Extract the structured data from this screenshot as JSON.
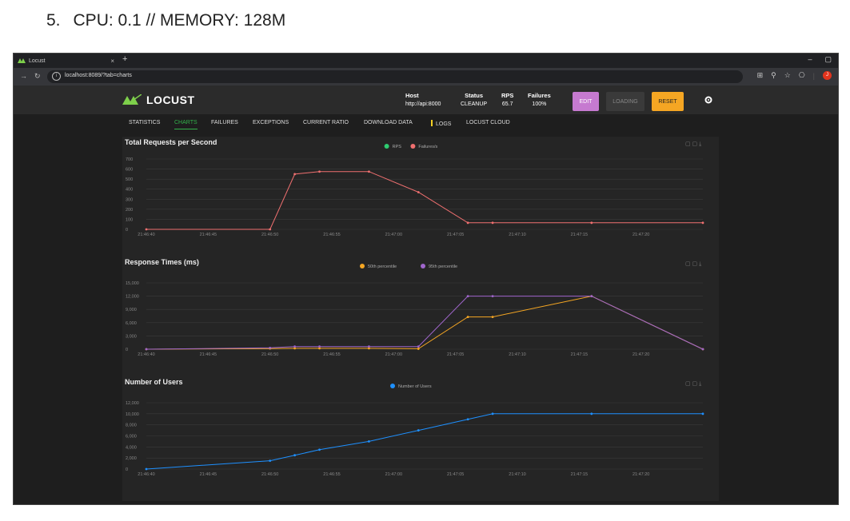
{
  "doc": {
    "number": "5.",
    "heading": "CPU: 0.1 // MEMORY: 128M"
  },
  "browser": {
    "tab_title": "Locust",
    "tab_close": "×",
    "new_tab": "+",
    "url": "localhost:8089/?tab=charts",
    "win_min": "–",
    "win_restore": "▢",
    "profile_initial": "J"
  },
  "header": {
    "logo": "LOCUST",
    "host_label": "Host",
    "host_value": "http://api:8000",
    "status_label": "Status",
    "status_value": "CLEANUP",
    "rps_label": "RPS",
    "rps_value": "65.7",
    "failures_label": "Failures",
    "failures_value": "100%",
    "edit": "EDIT",
    "loading": "LOADING",
    "reset": "RESET"
  },
  "nav": {
    "statistics": "STATISTICS",
    "charts": "CHARTS",
    "failures": "FAILURES",
    "exceptions": "EXCEPTIONS",
    "current_ratio": "CURRENT RATIO",
    "download_data": "DOWNLOAD DATA",
    "logs": "LOGS",
    "locust_cloud": "LOCUST CLOUD"
  },
  "colors": {
    "rps": "#2ecc71",
    "failures": "#f07070",
    "p50": "#f5a623",
    "p95": "#a066cc",
    "users": "#1e90ff",
    "accent": "#33b14a"
  },
  "chart_data": [
    {
      "type": "line",
      "title": "Total Requests per Second",
      "x": [
        "21:46:40",
        "21:46:45",
        "21:46:50",
        "21:46:55",
        "21:47:00",
        "21:47:05",
        "21:47:10",
        "21:47:15",
        "21:47:20"
      ],
      "ylim": [
        0,
        700
      ],
      "yticks": [
        0,
        100,
        200,
        300,
        400,
        500,
        600,
        700
      ],
      "ytick_labels": [
        "0",
        "100",
        "200",
        "300",
        "400",
        "500",
        "600",
        "700"
      ],
      "legend": "top-center",
      "series": [
        {
          "name": "RPS",
          "color": "#2ecc71",
          "points": []
        },
        {
          "name": "Failures/s",
          "color": "#f07070",
          "points": [
            [
              "21:46:40",
              0
            ],
            [
              "21:46:50",
              0
            ],
            [
              "21:46:52",
              550
            ],
            [
              "21:46:54",
              575
            ],
            [
              "21:46:58",
              575
            ],
            [
              "21:47:02",
              370
            ],
            [
              "21:47:06",
              65
            ],
            [
              "21:47:08",
              65
            ],
            [
              "21:47:16",
              65
            ],
            [
              "21:47:25",
              65
            ]
          ]
        }
      ]
    },
    {
      "type": "line",
      "title": "Response Times (ms)",
      "x": [
        "21:46:40",
        "21:46:45",
        "21:46:50",
        "21:46:55",
        "21:47:00",
        "21:47:05",
        "21:47:10",
        "21:47:15",
        "21:47:20"
      ],
      "ylim": [
        0,
        15000
      ],
      "yticks": [
        0,
        3000,
        6000,
        9000,
        12000,
        15000
      ],
      "ytick_labels": [
        "0",
        "3,000",
        "6,000",
        "9,000",
        "12,000",
        "15,000"
      ],
      "legend": "top-center",
      "series": [
        {
          "name": "50th percentile",
          "color": "#f5a623",
          "points": [
            [
              "21:46:40",
              0
            ],
            [
              "21:46:50",
              150
            ],
            [
              "21:46:52",
              200
            ],
            [
              "21:46:54",
              200
            ],
            [
              "21:46:58",
              200
            ],
            [
              "21:47:02",
              100
            ],
            [
              "21:47:06",
              7300
            ],
            [
              "21:47:08",
              7300
            ],
            [
              "21:47:16",
              12000
            ],
            [
              "21:47:25",
              0
            ]
          ]
        },
        {
          "name": "95th percentile",
          "color": "#a066cc",
          "points": [
            [
              "21:46:40",
              0
            ],
            [
              "21:46:50",
              300
            ],
            [
              "21:46:52",
              600
            ],
            [
              "21:46:54",
              600
            ],
            [
              "21:46:58",
              600
            ],
            [
              "21:47:02",
              600
            ],
            [
              "21:47:06",
              12000
            ],
            [
              "21:47:08",
              12000
            ],
            [
              "21:47:16",
              12000
            ],
            [
              "21:47:25",
              0
            ]
          ]
        }
      ]
    },
    {
      "type": "line",
      "title": "Number of Users",
      "x": [
        "21:46:40",
        "21:46:45",
        "21:46:50",
        "21:46:55",
        "21:47:00",
        "21:47:05",
        "21:47:10",
        "21:47:15",
        "21:47:20"
      ],
      "ylim": [
        0,
        12000
      ],
      "yticks": [
        0,
        2000,
        4000,
        6000,
        8000,
        10000,
        12000
      ],
      "ytick_labels": [
        "0",
        "2,000",
        "4,000",
        "6,000",
        "8,000",
        "10,000",
        "12,000"
      ],
      "legend": "top-center",
      "series": [
        {
          "name": "Number of Users",
          "color": "#1e90ff",
          "points": [
            [
              "21:46:40",
              0
            ],
            [
              "21:46:50",
              1500
            ],
            [
              "21:46:52",
              2500
            ],
            [
              "21:46:54",
              3500
            ],
            [
              "21:46:58",
              5000
            ],
            [
              "21:47:02",
              7000
            ],
            [
              "21:47:06",
              9000
            ],
            [
              "21:47:08",
              10000
            ],
            [
              "21:47:16",
              10000
            ],
            [
              "21:47:25",
              10000
            ]
          ]
        }
      ]
    }
  ]
}
